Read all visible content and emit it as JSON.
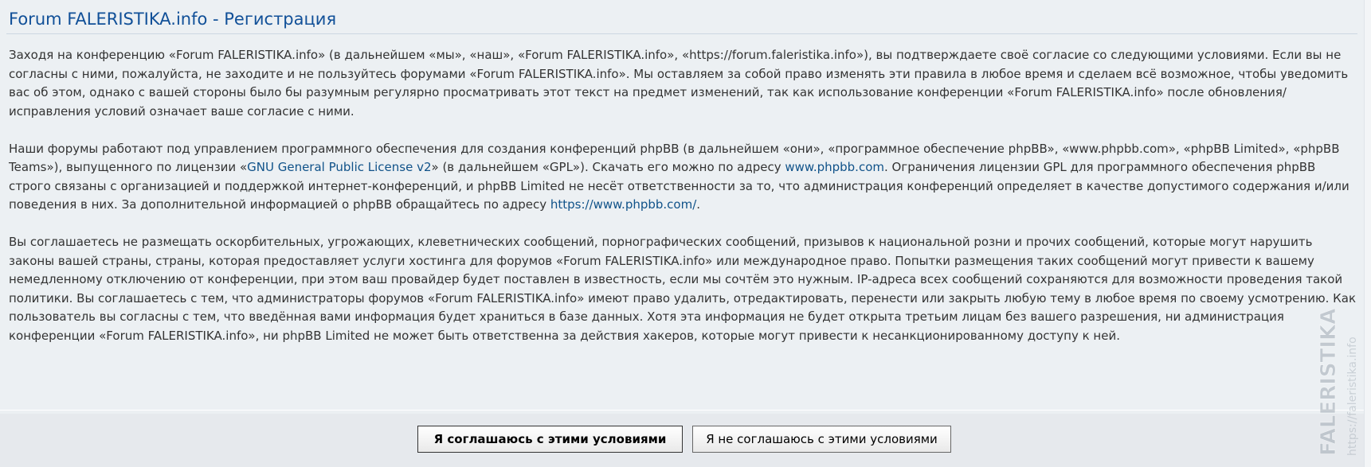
{
  "header": {
    "title": "Forum FALERISTIKA.info - Регистрация"
  },
  "terms": {
    "p1": "Заходя на конференцию «Forum FALERISTIKA.info» (в дальнейшем «мы», «наш», «Forum FALERISTIKA.info», «https://forum.faleristika.info»), вы подтверждаете своё согласие со следующими условиями. Если вы не согласны с ними, пожалуйста, не заходите и не пользуйтесь форумами «Forum FALERISTIKA.info». Мы оставляем за собой право изменять эти правила в любое время и сделаем всё возможное, чтобы уведомить вас об этом, однако с вашей стороны было бы разумным регулярно просматривать этот текст на предмет изменений, так как использование конференции «Forum FALERISTIKA.info» после обновления/исправления условий означает ваше согласие с ними.",
    "p2_part1": "Наши форумы работают под управлением программного обеспечения для создания конференций phpBB (в дальнейшем «они», «программное обеспечение phpBB», «www.phpbb.com», «phpBB Limited», «phpBB Teams»), выпущенного по лицензии «",
    "p2_link_gpl": "GNU General Public License v2",
    "p2_part2": "» (в дальнейшем «GPL»). Скачать его можно по адресу ",
    "p2_link_phpbb": "www.phpbb.com",
    "p2_part3": ". Ограничения лицензии GPL для программного обеспечения phpBB строго связаны с организацией и поддержкой интернет-конференций, и phpBB Limited не несёт ответственности за то, что администрация конференций определяет в качестве допустимого содержания и/или поведения в них. За дополнительной информацией о phpBB обращайтесь по адресу ",
    "p2_link_phpbb_url": "https://www.phpbb.com/",
    "p2_part4": ".",
    "p3": "Вы соглашаетесь не размещать оскорбительных, угрожающих, клеветнических сообщений, порнографических сообщений, призывов к национальной розни и прочих сообщений, которые могут нарушить законы вашей страны, страны, которая предоставляет услуги хостинга для форумов «Forum FALERISTIKA.info» или международное право. Попытки размещения таких сообщений могут привести к вашему немедленному отключению от конференции, при этом ваш провайдер будет поставлен в известность, если мы сочтём это нужным. IP-адреса всех сообщений сохраняются для возможности проведения такой политики. Вы соглашаетесь с тем, что администраторы форумов «Forum FALERISTIKA.info» имеют право удалить, отредактировать, перенести или закрыть любую тему в любое время по своему усмотрению. Как пользователь вы согласны с тем, что введённая вами информация будет храниться в базе данных. Хотя эта информация не будет открыта третьим лицам без вашего разрешения, ни администрация конференции «Forum FALERISTIKA.info», ни phpBB Limited не может быть ответственна за действия хакеров, которые могут привести к несанкционированному доступу к ней."
  },
  "actions": {
    "agree_label": "Я соглашаюсь с этими условиями",
    "disagree_label": "Я не соглашаюсь с этими условиями"
  },
  "watermark": {
    "brand": "FALERISTIKA",
    "url": "https://faleristika.info"
  },
  "colors": {
    "title": "#115098",
    "link": "#105289",
    "text": "#333333",
    "panel_bg": "#ecf0f3"
  }
}
